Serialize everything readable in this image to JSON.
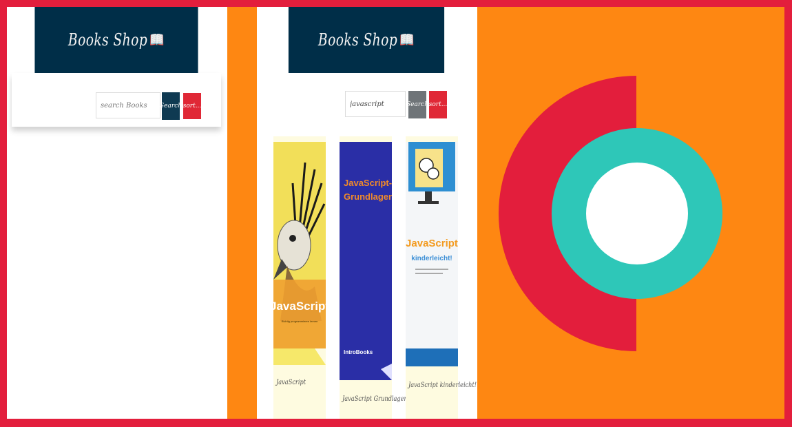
{
  "left_screen": {
    "header_title": "Books Shop",
    "search_placeholder": "search Books",
    "search_button": "Search",
    "sort_button": "sort..."
  },
  "right_screen": {
    "header_title": "Books Shop",
    "search_value": "javascript",
    "search_button": "Search",
    "sort_button": "sort...",
    "books": [
      {
        "title": "JavaScript",
        "cover_title": "JavaScript",
        "cover_subtitle": "Richtig programmieren lernen"
      },
      {
        "title": "JavaScript Grundlagen",
        "cover_title_line1": "JavaScript-",
        "cover_title_line2": "Grundlagen",
        "cover_publisher": "IntroBooks"
      },
      {
        "title": "JavaScript kinderleicht!",
        "cover_title": "JavaScript",
        "cover_subtitle": "kinderleicht!"
      }
    ]
  },
  "colors": {
    "header_navy": "#002e48",
    "accent_red": "#e31e3c",
    "background_orange": "#fe8712",
    "teal": "#2ec7b8"
  },
  "icons": [
    "open-book-icon",
    "brand-logo-icon"
  ]
}
